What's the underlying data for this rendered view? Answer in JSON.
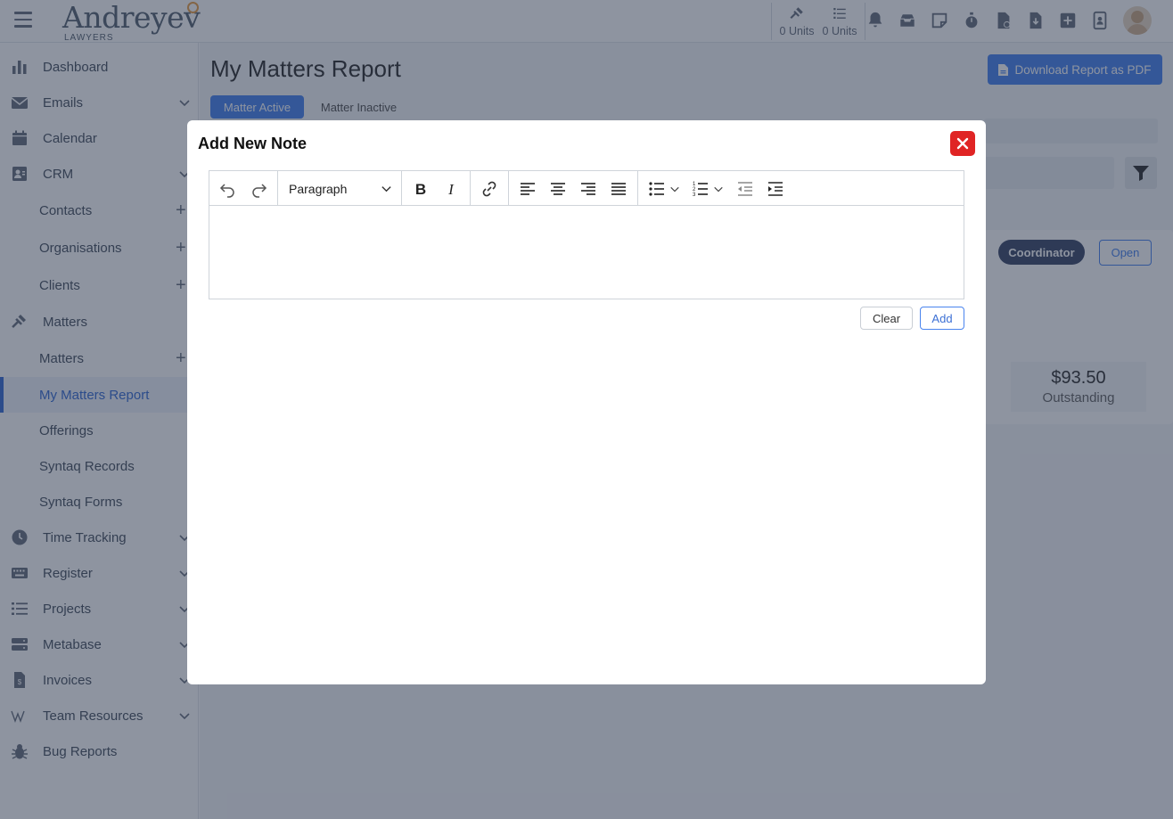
{
  "header": {
    "logo_text": "Andreyev",
    "logo_sub": "LAWYERS",
    "units": [
      {
        "icon": "gavel-icon",
        "label": "0 Units"
      },
      {
        "icon": "list-icon",
        "label": "0 Units"
      }
    ],
    "icons": [
      "bell-icon",
      "inbox-icon",
      "note-icon",
      "stopwatch-icon",
      "file-clock-icon",
      "file-download-icon",
      "plus-square-icon",
      "contact-card-icon"
    ]
  },
  "sidebar": {
    "items": [
      {
        "label": "Dashboard",
        "icon": "bar-chart-icon"
      },
      {
        "label": "Emails",
        "icon": "envelope-icon",
        "chevron": true
      },
      {
        "label": "Calendar",
        "icon": "calendar-icon"
      },
      {
        "label": "CRM",
        "icon": "id-card-icon",
        "chevron": true
      },
      {
        "label": "Contacts",
        "sub": true,
        "plus": true
      },
      {
        "label": "Organisations",
        "sub": true,
        "plus": true
      },
      {
        "label": "Clients",
        "sub": true,
        "plus": true
      },
      {
        "label": "Matters",
        "icon": "gavel-icon"
      },
      {
        "label": "Matters",
        "sub": true,
        "plus": true
      },
      {
        "label": "My Matters Report",
        "sub": true,
        "active": true
      },
      {
        "label": "Offerings",
        "sub": true
      },
      {
        "label": "Syntaq Records",
        "sub": true
      },
      {
        "label": "Syntaq Forms",
        "sub": true
      },
      {
        "label": "Time Tracking",
        "icon": "clock-icon",
        "chevron": true
      },
      {
        "label": "Register",
        "icon": "keyboard-icon",
        "chevron": true
      },
      {
        "label": "Projects",
        "icon": "list-icon",
        "chevron": true
      },
      {
        "label": "Metabase",
        "icon": "server-icon",
        "chevron": true
      },
      {
        "label": "Invoices",
        "icon": "invoice-icon",
        "chevron": true
      },
      {
        "label": "Team Resources",
        "icon": "wikipedia-icon",
        "chevron": true
      },
      {
        "label": "Bug Reports",
        "icon": "bug-icon"
      }
    ]
  },
  "main": {
    "title": "My Matters Report",
    "download_button": "Download Report as PDF",
    "tabs": [
      {
        "label": "Matter Active",
        "active": true
      },
      {
        "label": "Matter Inactive",
        "active": false
      }
    ],
    "card": {
      "badge": "Coordinator",
      "open_button": "Open",
      "amount": "$93.50",
      "amount_label": "Outstanding"
    }
  },
  "modal": {
    "title": "Add New Note",
    "toolbar": {
      "paragraph_select": "Paragraph"
    },
    "editor_content": "",
    "clear_button": "Clear",
    "add_button": "Add"
  },
  "colors": {
    "accent": "#4a84ee",
    "close_red": "#e02424",
    "overlay": "#1e2942",
    "badge": "#3f4b6b"
  }
}
